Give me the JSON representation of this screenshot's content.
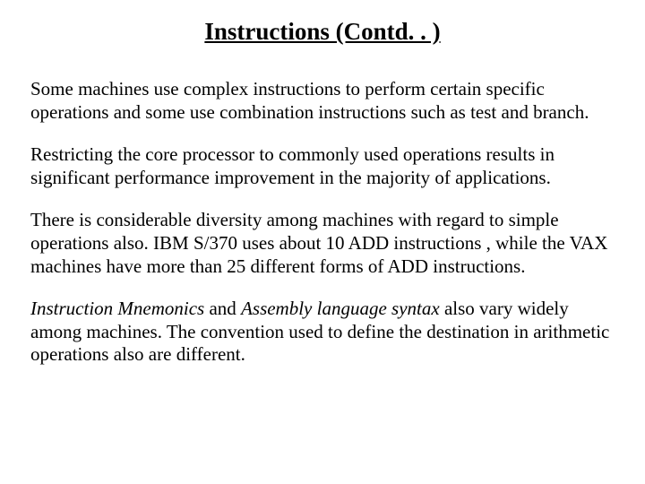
{
  "title": "Instructions (Contd. . )",
  "p1": "Some machines use complex instructions to perform certain specific operations and some use combination instructions such as test and branch.",
  "p2": "Restricting the core processor to commonly used operations results in significant performance improvement in the majority of applications.",
  "p3": "There is considerable diversity among machines with regard to simple operations also. IBM  S/370 uses about 10 ADD instructions , while the VAX machines have more than 25 different forms of ADD instructions.",
  "p4_part1": "Instruction Mnemonics",
  "p4_part2": " and ",
  "p4_part3": "Assembly language syntax",
  "p4_part4": " also vary widely among machines. The convention used to define the destination in arithmetic operations also are different."
}
